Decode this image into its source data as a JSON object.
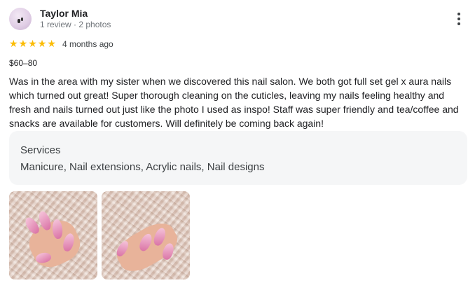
{
  "reviewer": {
    "name": "Taylor Mia",
    "meta": "1 review · 2 photos"
  },
  "review": {
    "rating_stars": 5,
    "time": "4 months ago",
    "price": "$60–80",
    "text": "Was in the area with my sister when we discovered this nail salon. We both got full set gel x aura nails which turned out great! Super thorough cleaning on the cuticles, leaving my nails feeling healthy and fresh and nails turned out just like the photo I used as inspo! Staff was super friendly and tea/coffee and snacks are available for customers. Will definitely be coming back again!"
  },
  "services": {
    "title": "Services",
    "list": "Manicure, Nail extensions, Acrylic nails, Nail designs"
  },
  "icons": {
    "more": "more-vert-icon",
    "star": "star-icon"
  },
  "colors": {
    "star": "#fbbc04",
    "services_bg": "#f5f6f7"
  }
}
